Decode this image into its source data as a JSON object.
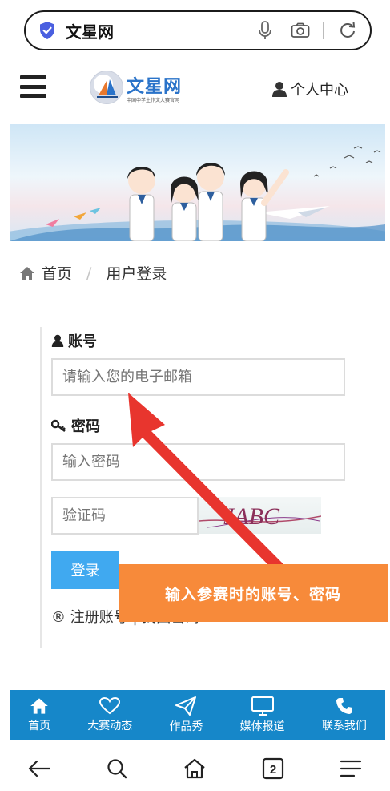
{
  "browser": {
    "site_name": "文星网",
    "tab_count": "2"
  },
  "header": {
    "logo_title": "文星网",
    "logo_subtitle": "中国中学生作文大赛官网",
    "user_center": "个人中心"
  },
  "breadcrumb": {
    "home": "首页",
    "separator": "/",
    "current": "用户登录"
  },
  "form": {
    "account_label": "账号",
    "account_placeholder": "请输入您的电子邮箱",
    "password_label": "密码",
    "password_placeholder": "输入密码",
    "captcha_placeholder": "验证码",
    "captcha_text": "JABC",
    "login_button": "登录",
    "register_link": "注册账号 | 找回密码"
  },
  "callout": {
    "text": "输入参赛时的账号、密码"
  },
  "bottom_nav": {
    "items": [
      {
        "label": "首页",
        "icon": "home-icon"
      },
      {
        "label": "大赛动态",
        "icon": "heart-icon"
      },
      {
        "label": "作品秀",
        "icon": "paper-plane-icon"
      },
      {
        "label": "媒体报道",
        "icon": "monitor-icon"
      },
      {
        "label": "联系我们",
        "icon": "phone-icon"
      }
    ]
  },
  "colors": {
    "accent_blue": "#1687c9",
    "button_blue": "#40a9f0",
    "callout_orange": "#f78a3a",
    "arrow_red": "#e8352e"
  }
}
